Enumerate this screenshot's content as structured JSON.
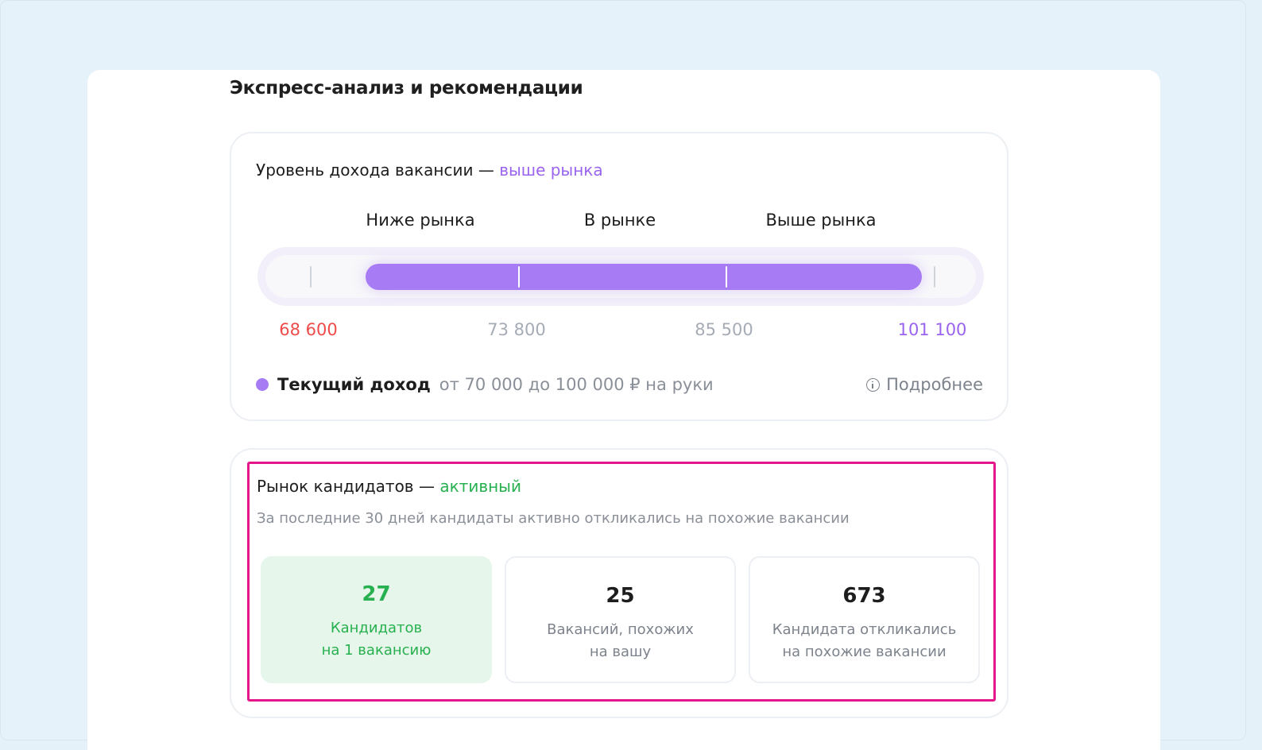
{
  "page": {
    "title": "Экспресс-анализ и рекомендации"
  },
  "income": {
    "title_prefix": "Уровень дохода вакансии —",
    "title_accent": "выше рынка",
    "zones": [
      "Ниже рынка",
      "В рынке",
      "Выше рынка"
    ],
    "scale": [
      {
        "value": "68 600",
        "color": "#ef4b4b"
      },
      {
        "value": "73 800",
        "color": "#a5acb5"
      },
      {
        "value": "85 500",
        "color": "#a5acb5"
      },
      {
        "value": "101 100",
        "color": "#9a64ee"
      }
    ],
    "current_range_fraction": {
      "from": 0.12,
      "to": 0.92
    },
    "current_label": "Текущий доход",
    "current_range": "от 70 000 до 100 000 ₽ на руки",
    "details_label": "Подробнее",
    "accent_color": "#a77bf4"
  },
  "market": {
    "title_prefix": "Рынок кандидатов —",
    "title_accent": "активный",
    "subtitle": "За последние 30 дней кандидаты активно откликались на похожие вакансии",
    "stats": [
      {
        "value": "27",
        "line1": "Кандидатов",
        "line2": "на 1 вакансию"
      },
      {
        "value": "25",
        "line1": "Вакансий, похожих",
        "line2": "на вашу"
      },
      {
        "value": "673",
        "line1": "Кандидата откликались",
        "line2": "на похожие вакансии"
      }
    ],
    "accent_color": "#27b04f"
  }
}
